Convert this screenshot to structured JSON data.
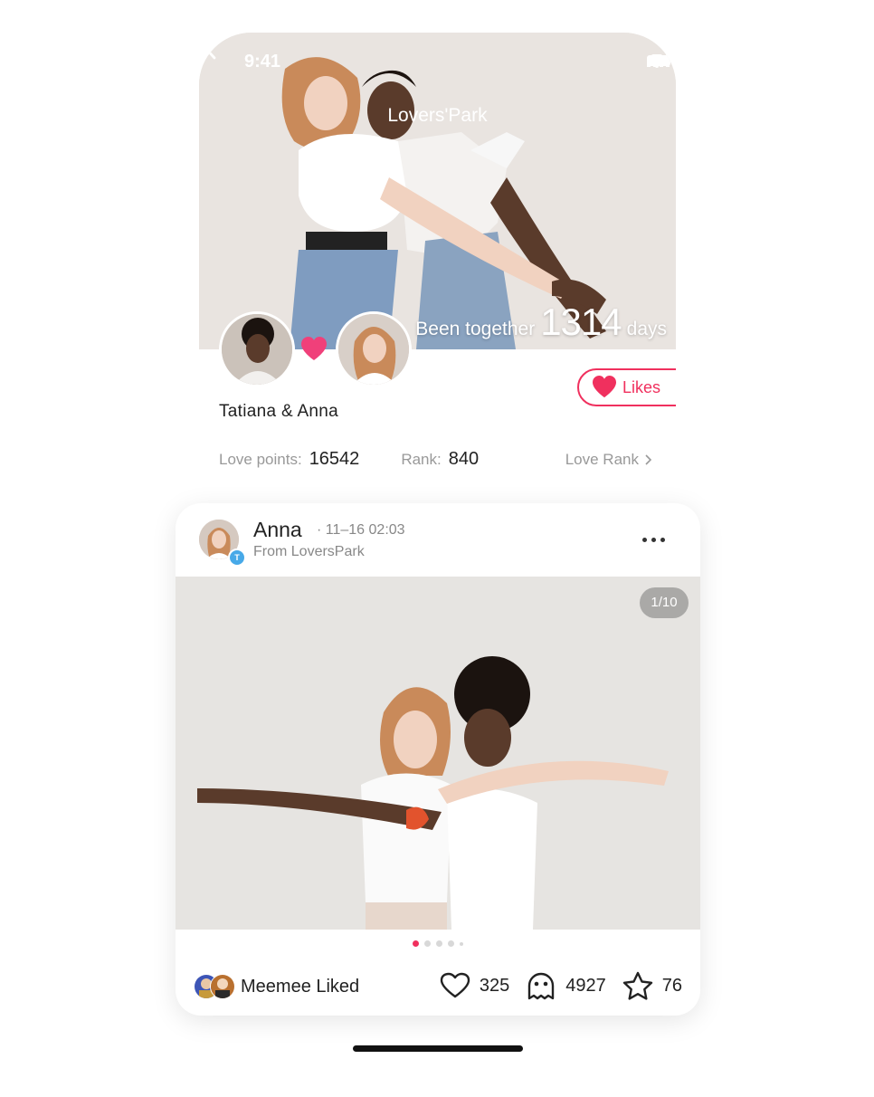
{
  "status_bar": {
    "time": "9:41"
  },
  "nav": {
    "title": "Lovers'Park",
    "back_icon": "chevron-left-icon"
  },
  "together": {
    "label": "Been together",
    "days": "1314",
    "unit": "days"
  },
  "couple": {
    "names": "Tatiana & Anna"
  },
  "likes_button": {
    "label": "Likes"
  },
  "stats": {
    "love_points_label": "Love points:",
    "love_points_value": "16542",
    "rank_label": "Rank:",
    "rank_value": "840",
    "love_rank_link": "Love Rank"
  },
  "post": {
    "author": "Anna",
    "time": "· 11–16 02:03",
    "source": "From LoversPark",
    "badge": "T",
    "counter": "1/10",
    "liked_text": "Meemee Liked",
    "likes": "325",
    "comments": "4927",
    "favorites": "76",
    "carousel": {
      "total_dots": 5,
      "active_index": 0
    }
  },
  "colors": {
    "accent": "#f0305e",
    "badge": "#47a9e8"
  }
}
